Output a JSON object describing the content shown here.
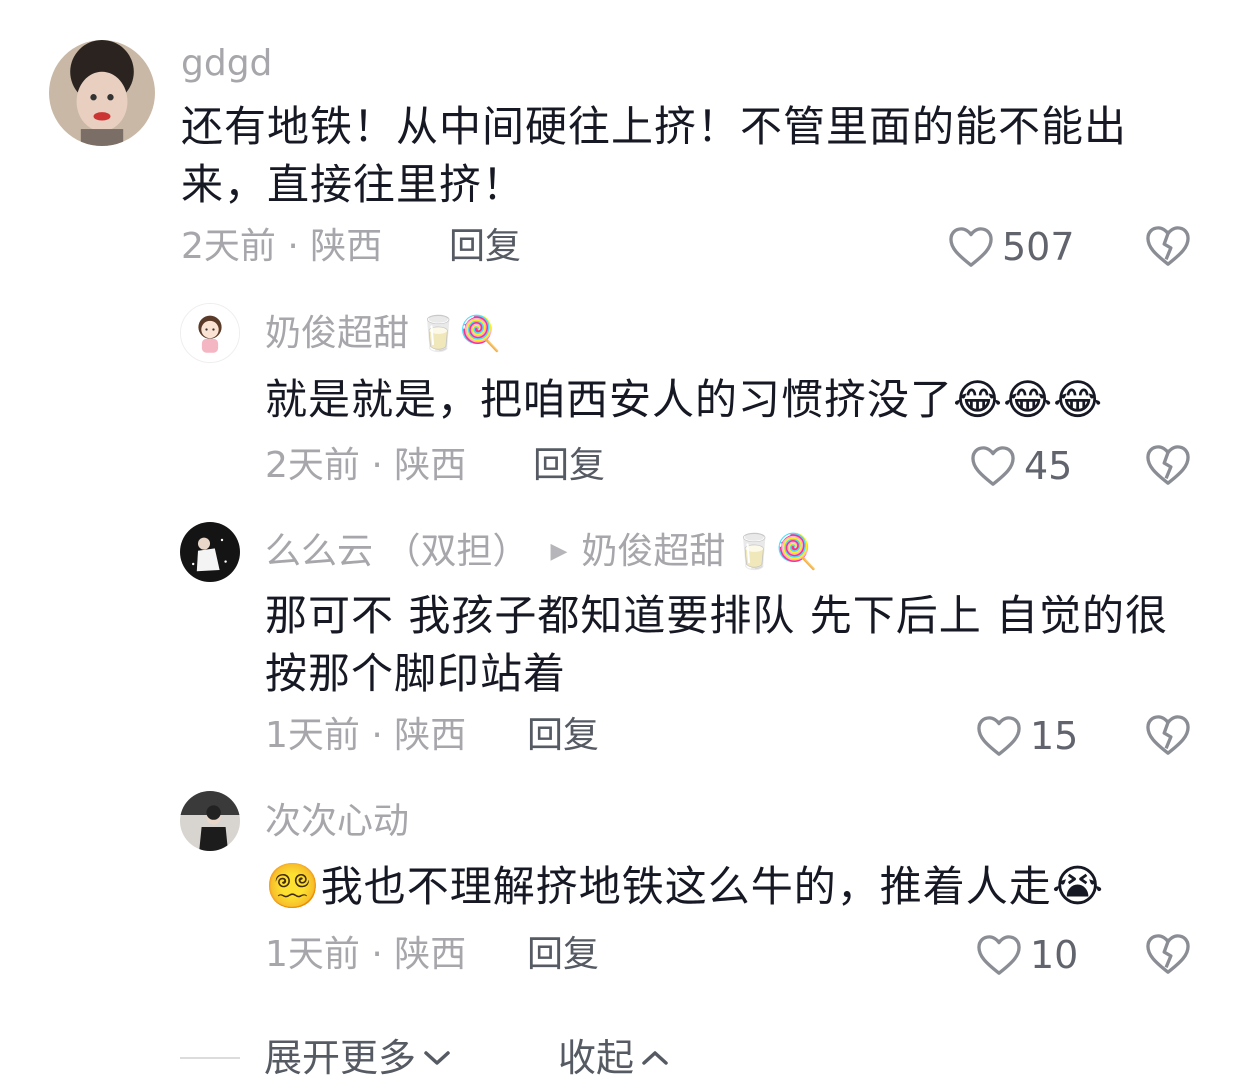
{
  "comments": [
    {
      "author": "gdgd",
      "author_emoji": "",
      "text": "还有地铁！从中间硬往上挤！不管里面的能不能出来，直接往里挤！",
      "time_location": "2天前 · 陕西",
      "reply_label": "回复",
      "likes": "507"
    },
    {
      "author": "奶俊超甜",
      "author_emoji": "🥛🍭",
      "text": "就是就是，把咱西安人的习惯挤没了😂😂😂",
      "time_location": "2天前 · 陕西",
      "reply_label": "回复",
      "likes": "45"
    },
    {
      "author": "么么云 （双担）",
      "reply_to": "奶俊超甜",
      "author_emoji": "🥛🍭",
      "text": "那可不 我孩子都知道要排队 先下后上 自觉的很 按那个脚印站着",
      "time_location": "1天前 · 陕西",
      "reply_label": "回复",
      "likes": "15"
    },
    {
      "author": "次次心动",
      "author_emoji": "",
      "text_emoji_lead": "😵‍💫",
      "text": "我也不理解挤地铁这么牛的，推着人走",
      "text_emoji_tail": "😭",
      "time_location": "1天前 · 陕西",
      "reply_label": "回复",
      "likes": "10"
    }
  ],
  "footer": {
    "expand_label": "展开更多",
    "collapse_label": "收起"
  },
  "icons": {
    "like": "heart-outline-icon",
    "dislike": "broken-heart-icon",
    "expand": "chevron-down-icon",
    "collapse": "chevron-up-icon"
  }
}
